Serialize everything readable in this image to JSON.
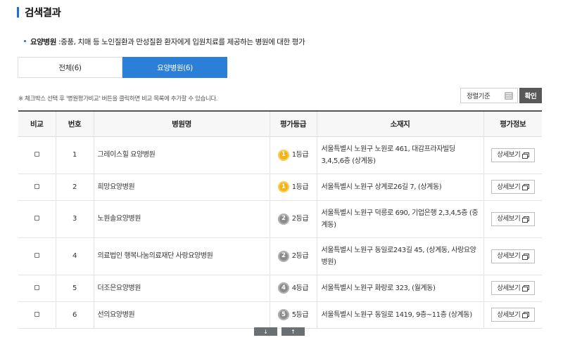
{
  "section": {
    "title": "검색결과"
  },
  "description": {
    "term": "요양병원",
    "text": " :중풍, 치매 등 노인질환과 만성질환 환자에게 입원치료를 제공하는 병원에 대한 평가"
  },
  "tabs": [
    {
      "label": "전체(6)",
      "active": false
    },
    {
      "label": "요양병원(6)",
      "active": true
    }
  ],
  "notice": "※ 체크박스 선택 후 '병원평가비교' 버튼을 클릭하면 비교 목록에 추가할 수 있습니다.",
  "sort": {
    "label": "정렬기준",
    "confirm_label": "확인"
  },
  "table": {
    "headers": [
      "비교",
      "번호",
      "병원명",
      "평가등급",
      "소재지",
      "평가정보"
    ],
    "detail_label": "상세보기",
    "rows": [
      {
        "no": "1",
        "name": "그레이스힐 요양병원",
        "grade_num": "1",
        "grade": "1등급",
        "address": "서울특별시 노원구 노원로 461, 대감프라자빌딩 3,4,5,6층 (상계동)"
      },
      {
        "no": "2",
        "name": "희망요양병원",
        "grade_num": "1",
        "grade": "1등급",
        "address": "서울특별시 노원구 상계로26길 7, (상계동)"
      },
      {
        "no": "3",
        "name": "노원솔요양병원",
        "grade_num": "2",
        "grade": "2등급",
        "address": "서울특별시 노원구 덕릉로 690, 기업은행 2,3,4,5층 (중계동)"
      },
      {
        "no": "4",
        "name": "의료법인 행복나눔의료재단 사랑요양병원",
        "grade_num": "2",
        "grade": "2등급",
        "address": "서울특별시 노원구 동일로243길 45, (상계동, 사랑요양병원)"
      },
      {
        "no": "5",
        "name": "더조은요양병원",
        "grade_num": "4",
        "grade": "4등급",
        "address": "서울특별시 노원구 화랑로 323, (월계동)"
      },
      {
        "no": "6",
        "name": "선의요양병원",
        "grade_num": "5",
        "grade": "5등급",
        "address": "서울특별시 노원구 동일로 1419, 9층~11층 (상계동)"
      }
    ]
  },
  "scroll": {
    "down_glyph": "↓",
    "up_glyph": "↑"
  },
  "colors": {
    "accent": "#2b7fd8",
    "grade_gold": "#f2b418",
    "grade_gray": "#8c8c8c",
    "confirm_bg": "#595959"
  },
  "icons": {
    "sort": "list-icon",
    "detail": "new-window-icon",
    "checkbox": "checkbox-icon"
  }
}
